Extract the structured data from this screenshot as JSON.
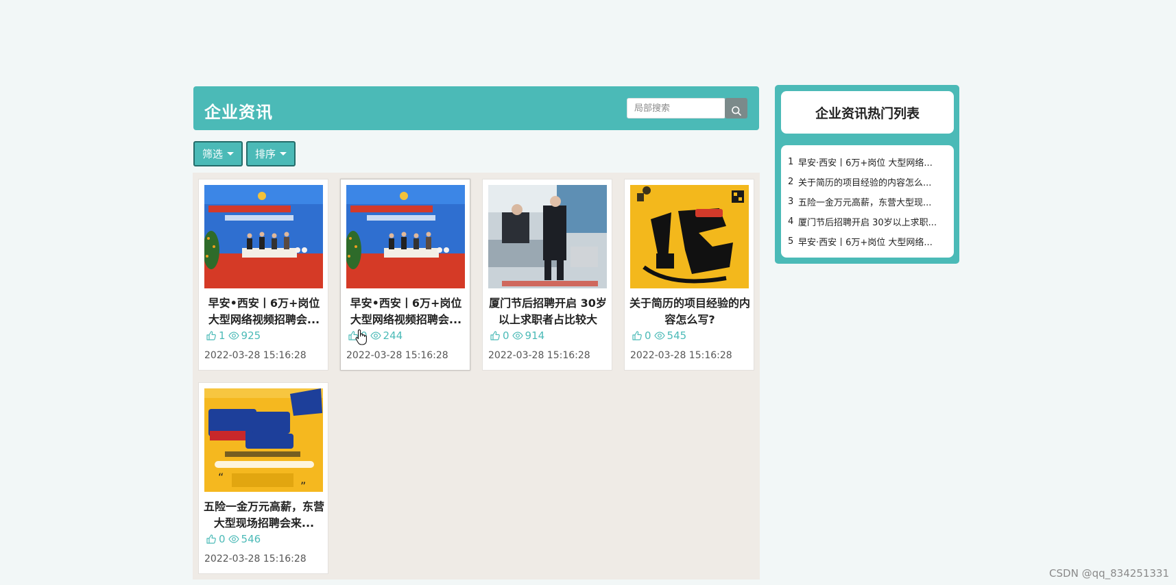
{
  "header": {
    "title": "企业资讯",
    "search_placeholder": "局部搜索",
    "search_icon": "search-icon"
  },
  "toolbar": {
    "filter_label": "筛选",
    "sort_label": "排序"
  },
  "colors": {
    "accent": "#4bbab7",
    "page_bg": "#f2f7f7",
    "panel_bg": "#efebe6",
    "button_border": "#246c6a",
    "search_button": "#7b8a8a"
  },
  "cards": [
    {
      "title": "早安•西安丨6万+岗位大型网络视频招聘会...",
      "likes": "1",
      "views": "925",
      "date": "2022-03-28 15:16:28"
    },
    {
      "title": "早安•西安丨6万+岗位大型网络视频招聘会...",
      "likes": "0",
      "views": "244",
      "date": "2022-03-28 15:16:28"
    },
    {
      "title": "厦门节后招聘开启 30岁以上求职者占比较大",
      "likes": "0",
      "views": "914",
      "date": "2022-03-28 15:16:28"
    },
    {
      "title": "关于简历的项目经验的内容怎么写?",
      "likes": "0",
      "views": "545",
      "date": "2022-03-28 15:16:28"
    },
    {
      "title": "五险一金万元高薪，东营大型现场招聘会来...",
      "likes": "0",
      "views": "546",
      "date": "2022-03-28 15:16:28"
    }
  ],
  "hot": {
    "title": "企业资讯热门列表",
    "items": [
      {
        "num": "1",
        "text": "早安·西安丨6万+岗位 大型网络..."
      },
      {
        "num": "2",
        "text": "关于简历的项目经验的内容怎么..."
      },
      {
        "num": "3",
        "text": "五险一金万元高薪，东营大型现..."
      },
      {
        "num": "4",
        "text": "厦门节后招聘开启 30岁以上求职..."
      },
      {
        "num": "5",
        "text": "早安·西安丨6万+岗位 大型网络..."
      }
    ]
  },
  "watermark": "CSDN @qq_834251331"
}
